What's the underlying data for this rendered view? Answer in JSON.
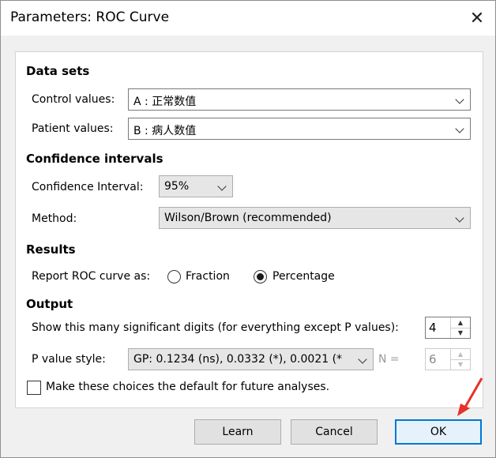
{
  "window": {
    "title": "Parameters: ROC Curve",
    "close_glyph": "✕"
  },
  "data_sets": {
    "heading": "Data sets",
    "control_label": "Control values:",
    "control_value": "A : 正常数值",
    "patient_label": "Patient values:",
    "patient_value": "B : 病人数值"
  },
  "confidence": {
    "heading": "Confidence intervals",
    "interval_label": "Confidence Interval:",
    "interval_value": "95%",
    "method_label": "Method:",
    "method_value": "Wilson/Brown (recommended)"
  },
  "results": {
    "heading": "Results",
    "report_label": "Report ROC curve as:",
    "option_fraction": "Fraction",
    "option_percentage": "Percentage",
    "selected": "Percentage"
  },
  "output": {
    "heading": "Output",
    "digits_label": "Show this many significant digits (for everything except P values):",
    "digits_value": "4",
    "pstyle_label": "P value style:",
    "pstyle_value": "GP: 0.1234 (ns), 0.0332 (*), 0.0021 (*",
    "n_label": "N =",
    "n_value": "6"
  },
  "default_checkbox": {
    "label": "Make these choices the default for future analyses.",
    "checked": false
  },
  "buttons": {
    "learn": "Learn",
    "cancel": "Cancel",
    "ok": "OK"
  },
  "colors": {
    "accent": "#0078d7",
    "pointer": "#e8302a"
  }
}
